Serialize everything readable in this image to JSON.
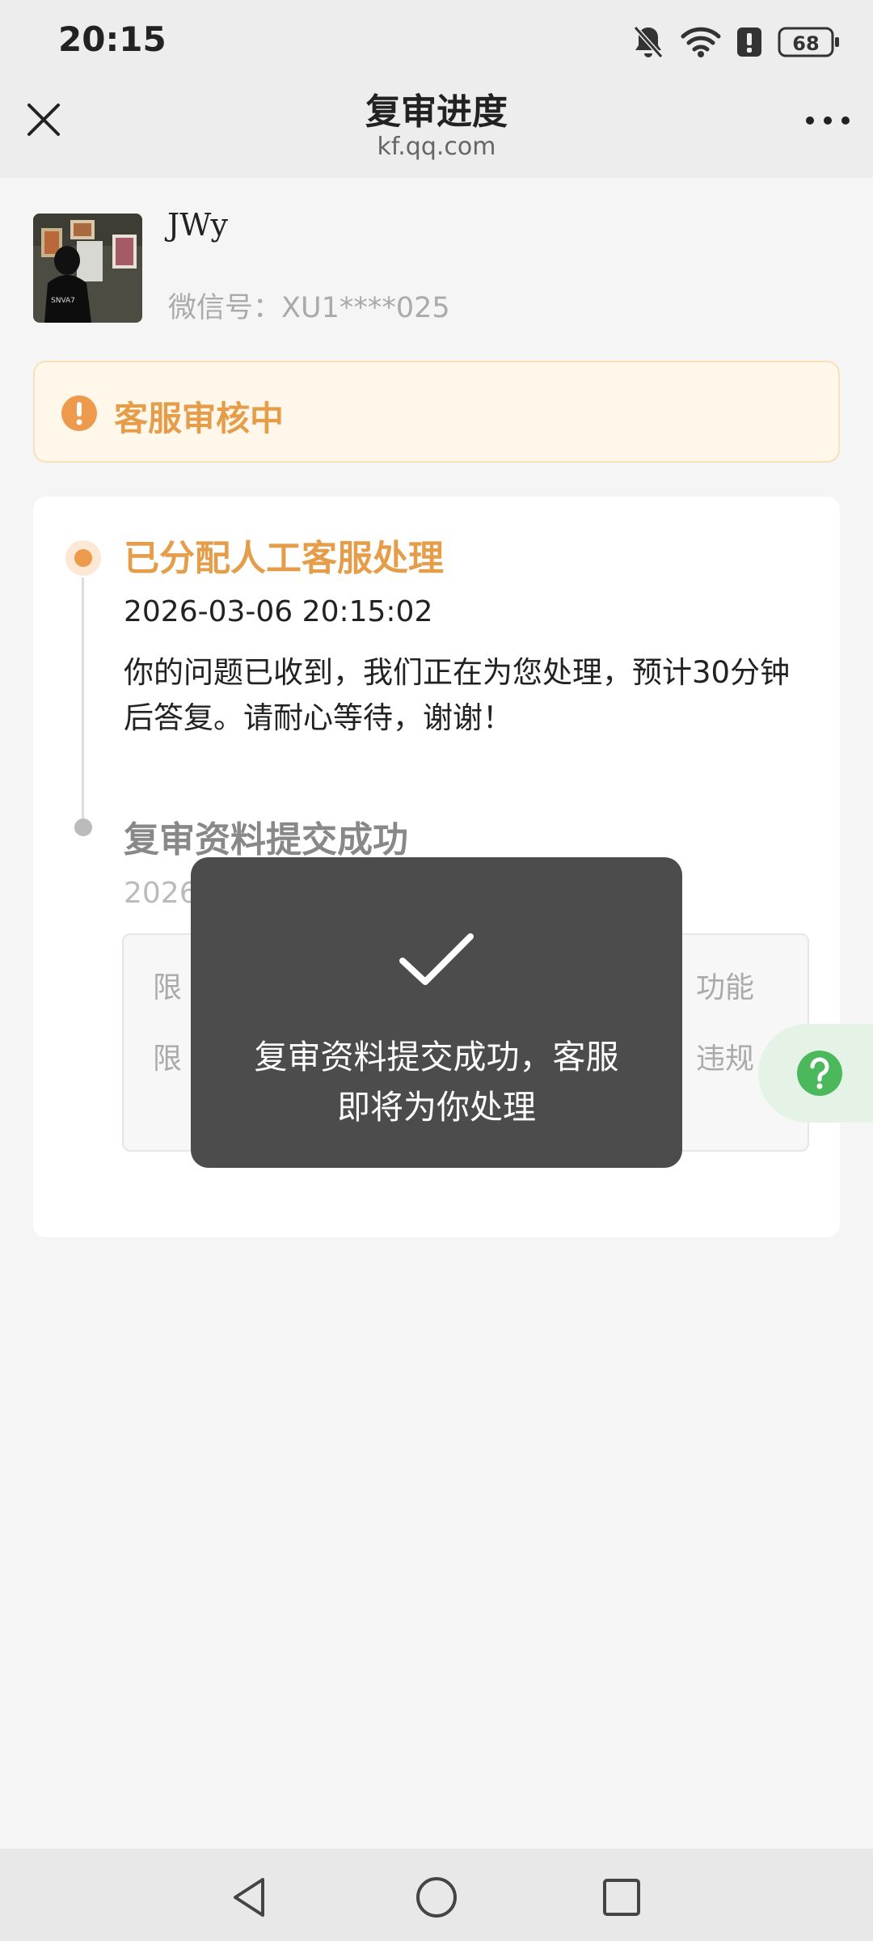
{
  "status_bar": {
    "time": "20:15",
    "battery": "68",
    "icons": [
      "bell-muted-icon",
      "wifi-icon",
      "alert-icon",
      "battery-icon"
    ]
  },
  "nav": {
    "title": "复审进度",
    "subtitle": "kf.qq.com",
    "icons": [
      "close-icon",
      "more-icon"
    ]
  },
  "profile": {
    "nickname": "JWy",
    "wechat_id": "微信号：XU1****025"
  },
  "status_banner": {
    "text": "客服审核中",
    "icon": "exclamation-icon",
    "color": "#e69d4a",
    "background": "#fff8ea"
  },
  "timeline": [
    {
      "title": "已分配人工客服处理",
      "time": "2026-03-06 20:15:02",
      "description": "你的问题已收到，我们正在为您处理，预计30分钟后答复。请耐心等待，谢谢！",
      "active": true
    },
    {
      "title": "复审资料提交成功",
      "time_visible": "2026",
      "details_visible": [
        "限",
        "功能",
        "限",
        "违规"
      ],
      "active": false
    }
  ],
  "toast": {
    "icon": "checkmark-icon",
    "text": "复审资料提交成功，客服即将为你处理"
  },
  "help_button": {
    "icon": "question-icon",
    "color": "#4cb85c"
  },
  "bottom_nav": [
    "back-icon",
    "home-icon",
    "recent-apps-icon"
  ]
}
